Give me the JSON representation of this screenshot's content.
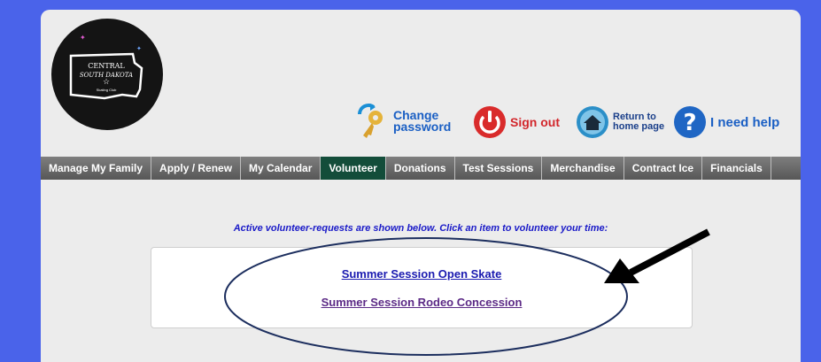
{
  "logo": {
    "line1": "CENTRAL",
    "line2": "SOUTH DAKOTA",
    "line3": "Skating Club"
  },
  "actions": {
    "change_password_line1": "Change",
    "change_password_line2": "password",
    "sign_out": "Sign out",
    "return_home_line1": "Return to",
    "return_home_line2": "home page",
    "help": "I need help"
  },
  "nav": {
    "tabs": [
      "Manage My Family",
      "Apply / Renew",
      "My Calendar",
      "Volunteer",
      "Donations",
      "Test Sessions",
      "Merchandise",
      "Contract Ice",
      "Financials"
    ],
    "active": "Volunteer"
  },
  "main": {
    "intro": "Active volunteer-requests are shown below.  Click an item to volunteer your time:",
    "requests": [
      "Summer Session Open Skate",
      "Summer Session Rodeo Concession"
    ]
  },
  "colors": {
    "background": "#4a63ea",
    "nav_active": "#134d3a",
    "link": "#1a1ab0",
    "visited_link": "#5c2a86"
  }
}
